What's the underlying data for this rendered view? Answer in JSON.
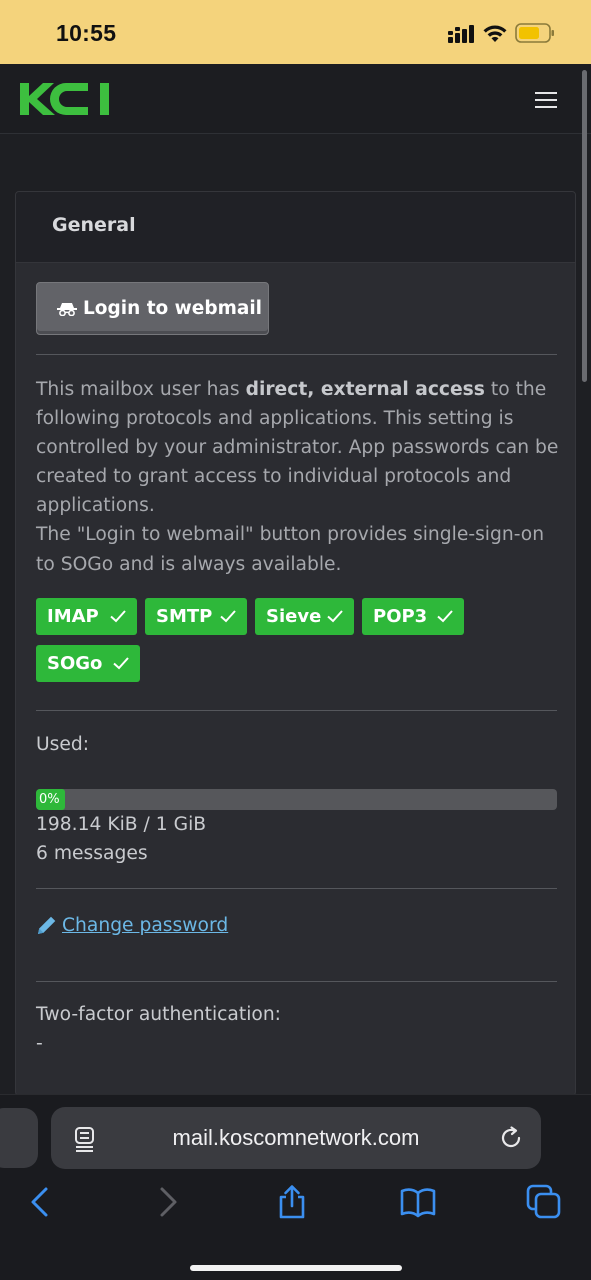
{
  "status_bar": {
    "time": "10:55",
    "background": "#f4d37c"
  },
  "navbar": {
    "logo_text": "KCI",
    "logo_color": "#3dbf3f",
    "menu_icon": "hamburger-icon"
  },
  "card": {
    "title": "General",
    "webmail_button": {
      "icon": "incognito-icon",
      "label": "Login to webmail"
    },
    "description": {
      "part1": "This mailbox user has ",
      "bold": "direct, external access",
      "part2": " to the following protocols and applications. This setting is controlled by your administrator. App passwords can be created to grant access to individual protocols and applications.",
      "part3": "The \"Login to webmail\" button provides single-sign-on to SOGo and is always available."
    },
    "protocols": [
      "IMAP",
      "SMTP",
      "Sieve",
      "POP3",
      "SOGo"
    ],
    "badge_color": "#2eb83a",
    "usage": {
      "label": "Used:",
      "percent_text": "0%",
      "percent_value": 0,
      "size": "198.14 KiB / 1 GiB",
      "messages": "6 messages"
    },
    "change_password": {
      "icon": "pencil-icon",
      "label": "Change password",
      "color": "#6cb8e6"
    },
    "two_factor": {
      "label": "Two-factor authentication:",
      "value": "-"
    }
  },
  "browser": {
    "url": "mail.koscomnetwork.com",
    "toolbar_icons": [
      "back-icon",
      "forward-icon",
      "share-icon",
      "bookmarks-icon",
      "tabs-icon"
    ]
  }
}
